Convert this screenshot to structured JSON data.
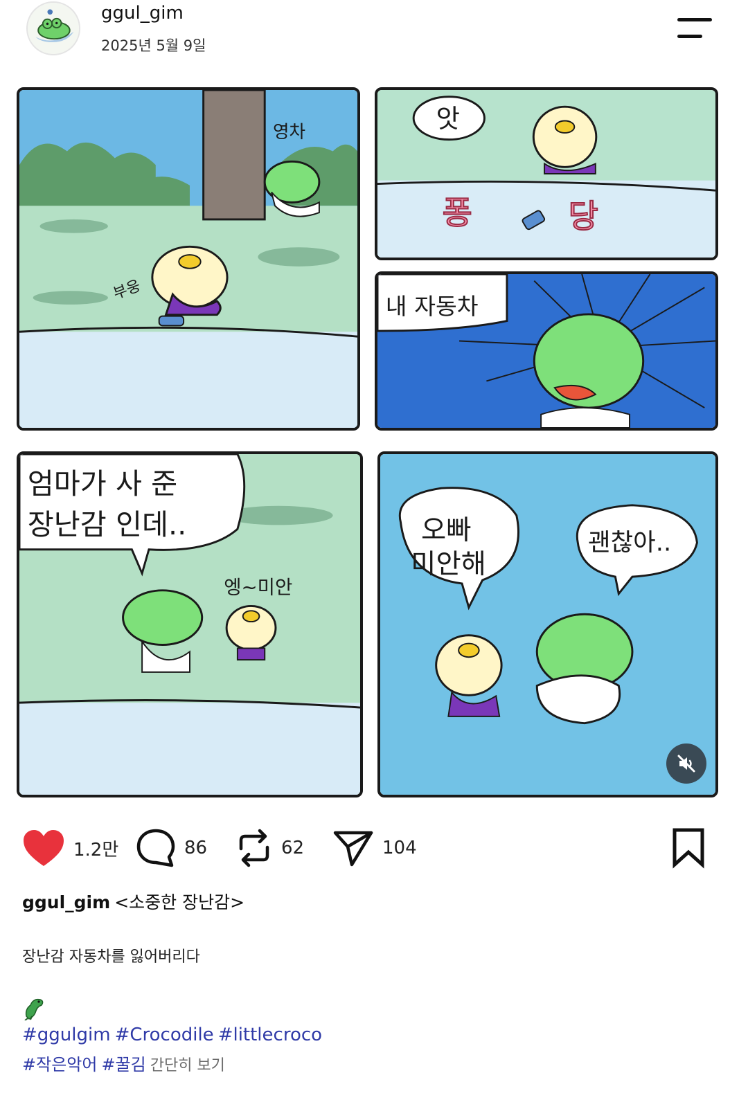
{
  "header": {
    "username": "ggul_gim",
    "date": "2025년 5월 9일",
    "avatar_icon": "crocodile-avatar-icon",
    "menu_icon": "menu-icon"
  },
  "comic": {
    "panel1": {
      "sfx_top": "영차",
      "sfx_car": "부웅"
    },
    "panel2": {
      "bubble": "앗",
      "sfx_left": "퐁",
      "sfx_right": "당"
    },
    "panel3": {
      "bubble": "내 자동차"
    },
    "panel4": {
      "bubble_line1": "엄마가 사 준",
      "bubble_line2": "장난감 인데..",
      "side_text": "엥~미안"
    },
    "panel5": {
      "bubble_left_line1": "오빠",
      "bubble_left_line2": "미안해",
      "bubble_right": "괜찮아.."
    },
    "mute_icon": "speaker-muted-icon"
  },
  "actions": {
    "likes": "1.2만",
    "comments": "86",
    "reposts": "62",
    "shares": "104",
    "like_color": "#e8323c"
  },
  "caption": {
    "username": "ggul_gim",
    "title": "<소중한 장난감>",
    "body": "장난감 자동차를 잃어버리다",
    "hashtags_line1": [
      "#ggulgim",
      "#Crocodile",
      "#littlecroco"
    ],
    "hashtags_line2": [
      "#작은악어",
      "#꿀김"
    ],
    "more_label": "간단히 보기"
  }
}
